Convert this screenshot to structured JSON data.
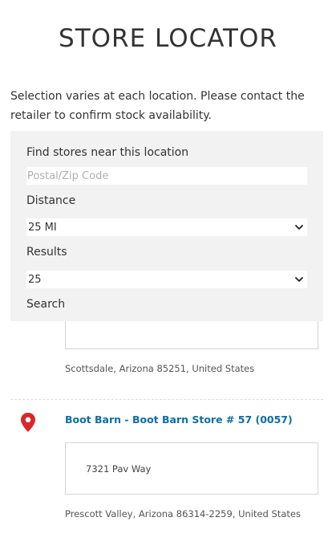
{
  "page": {
    "title": "STORE LOCATOR",
    "intro": "Selection varies at each location. Please contact the retailer to confirm stock availability."
  },
  "search_panel": {
    "find_label": "Find stores near this location",
    "postal_placeholder": "Postal/Zip Code",
    "postal_value": "",
    "distance_label": "Distance",
    "distance_value": "25 MI",
    "results_label": "Results",
    "results_value": "25",
    "search_label": "Search"
  },
  "results": [
    {
      "name": "",
      "address_line": "",
      "city_line": "Scottsdale, Arizona 85251, United States"
    },
    {
      "name": "Boot Barn - Boot Barn Store # 57 (0057)",
      "address_line": "7321 Pav Way",
      "city_line": "Prescott Valley, Arizona 86314-2259, United States"
    }
  ],
  "colors": {
    "panel_bg": "#f2f2f2",
    "store_link": "#0d6ea5",
    "pin": "#d9262b"
  },
  "icons": {
    "pin": "map-pin-icon",
    "select_arrow": "chevron-down-icon"
  }
}
